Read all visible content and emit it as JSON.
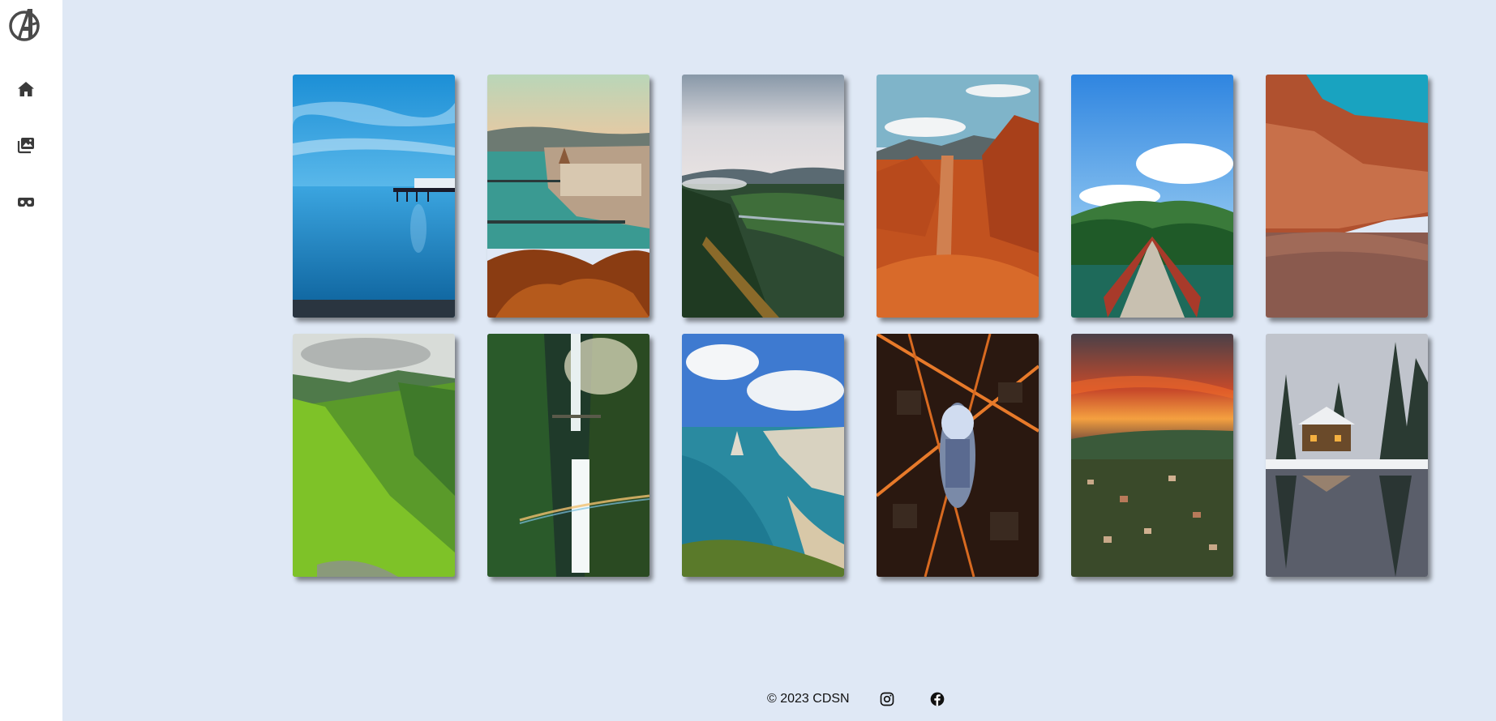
{
  "sidebar": {
    "logo_icon": "avengers-logo-icon",
    "items": [
      {
        "name": "home",
        "icon": "home-icon"
      },
      {
        "name": "gallery",
        "icon": "photo-album-icon"
      },
      {
        "name": "vr",
        "icon": "vr-goggles-icon"
      }
    ]
  },
  "gallery": {
    "cards": [
      {
        "subject": "pier-lake",
        "icon": "landscape-photo"
      },
      {
        "subject": "river-city-bridges",
        "icon": "landscape-photo"
      },
      {
        "subject": "valley-river",
        "icon": "landscape-photo"
      },
      {
        "subject": "red-rock-canyon",
        "icon": "landscape-photo"
      },
      {
        "subject": "suspension-bridge",
        "icon": "landscape-photo"
      },
      {
        "subject": "rock-cliff-beach",
        "icon": "landscape-photo"
      },
      {
        "subject": "green-valley",
        "icon": "landscape-photo"
      },
      {
        "subject": "waterfall",
        "icon": "landscape-photo"
      },
      {
        "subject": "sea-cliffs",
        "icon": "landscape-photo"
      },
      {
        "subject": "city-night-aerial",
        "icon": "landscape-photo"
      },
      {
        "subject": "sunset-town",
        "icon": "landscape-photo"
      },
      {
        "subject": "snowy-cabin-lake",
        "icon": "landscape-photo"
      }
    ]
  },
  "footer": {
    "copyright": "© 2023 CDSN",
    "social": [
      {
        "name": "instagram",
        "icon": "instagram-icon"
      },
      {
        "name": "facebook",
        "icon": "facebook-icon"
      }
    ]
  },
  "colors": {
    "background": "#dfe8f5",
    "sidebar": "#ffffff",
    "icon": "#3a3a3a"
  }
}
